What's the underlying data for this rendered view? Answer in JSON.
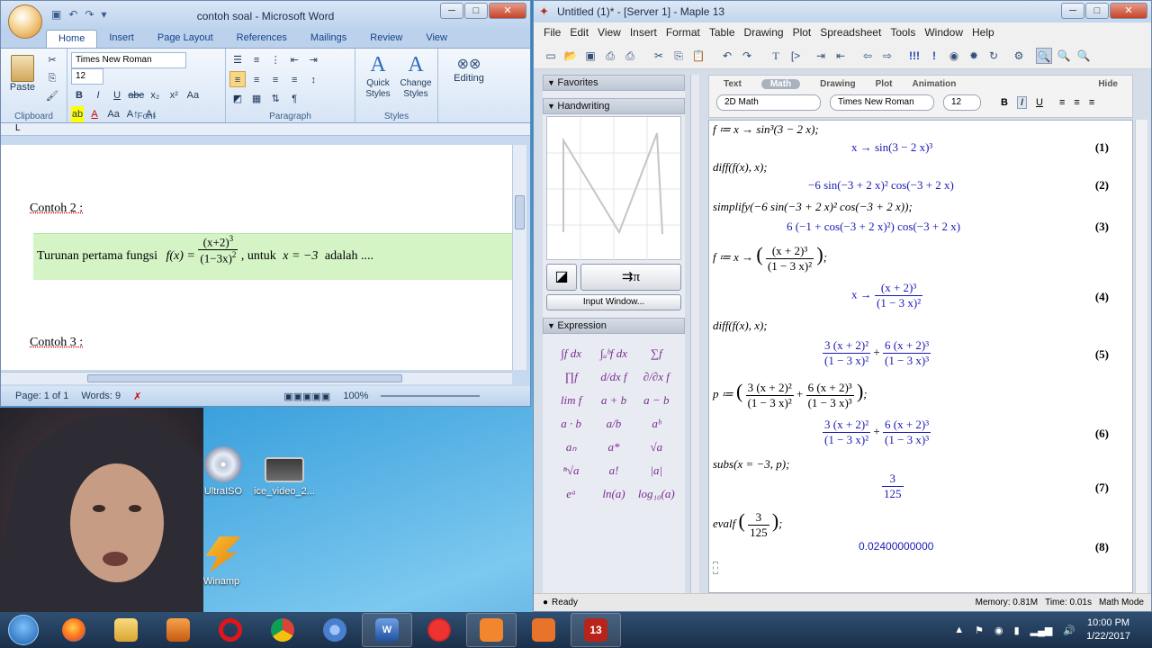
{
  "desktop": {
    "icons": [
      {
        "label": "UltraISO"
      },
      {
        "label": "ice_video_2..."
      },
      {
        "label": "Winamp"
      }
    ]
  },
  "word": {
    "title": "contoh soal - Microsoft Word",
    "tabs": [
      "Home",
      "Insert",
      "Page Layout",
      "References",
      "Mailings",
      "Review",
      "View"
    ],
    "active_tab": "Home",
    "font_name": "Times New Roman",
    "font_size": "12",
    "groups": {
      "clipboard": "Clipboard",
      "font": "Font",
      "paragraph": "Paragraph",
      "styles": "Styles"
    },
    "buttons": {
      "paste": "Paste",
      "quick_styles": "Quick Styles",
      "change_styles": "Change Styles",
      "editing": "Editing"
    },
    "doc": {
      "heading2": "Contoh 2 :",
      "question_prefix": "Turunan pertama fungsi",
      "question_fx": "f(x) =",
      "question_num": "(x+2)",
      "question_num_exp": "3",
      "question_den": "(1−3x)",
      "question_den_exp": "2",
      "question_suffix": ", untuk",
      "question_cond": "x = −3",
      "question_end": "adalah ....",
      "heading3": "Contoh 3 :"
    },
    "status": {
      "page": "Page: 1 of 1",
      "words": "Words: 9",
      "zoom": "100%"
    }
  },
  "maple": {
    "title": "Untitled (1)* - [Server 1] - Maple 13",
    "menu": [
      "File",
      "Edit",
      "View",
      "Insert",
      "Format",
      "Table",
      "Drawing",
      "Plot",
      "Spreadsheet",
      "Tools",
      "Window",
      "Help"
    ],
    "palettes": {
      "favorites": "Favorites",
      "handwriting": "Handwriting",
      "input_window": "Input Window...",
      "expression": "Expression"
    },
    "ctx_tabs": [
      "Text",
      "Math",
      "Drawing",
      "Plot",
      "Animation"
    ],
    "ctx_hide": "Hide",
    "ctx_mode": "2D Math",
    "ctx_font": "Times New Roman",
    "ctx_size": "12",
    "status": {
      "ready": "Ready",
      "memory": "Memory: 0.81M",
      "time": "Time: 0.01s",
      "mode": "Math Mode"
    }
  },
  "worksheet": {
    "in1": "f ≔ x → sin³(3 − 2 x);",
    "out1": "x → sin(3 − 2 x)³",
    "n1": "(1)",
    "in2": "diff(f(x), x);",
    "out2": "−6 sin(−3 + 2 x)² cos(−3 + 2 x)",
    "n2": "(2)",
    "in3": "simplify(−6 sin(−3 + 2 x)² cos(−3 + 2 x));",
    "out3": "6 (−1 + cos(−3 + 2 x)²) cos(−3 + 2 x)",
    "n3": "(3)",
    "in4_prefix": "f ≔ x →",
    "in4_num": "(x + 2)³",
    "in4_den": "(1 − 3 x)²",
    "out4_prefix": "x →",
    "out4_num": "(x + 2)³",
    "out4_den": "(1 − 3 x)²",
    "n4": "(4)",
    "in5": "diff(f(x), x);",
    "out5_a_num": "3 (x + 2)²",
    "out5_a_den": "(1 − 3 x)²",
    "out5_b_num": "6 (x + 2)³",
    "out5_b_den": "(1 − 3 x)³",
    "n5": "(5)",
    "in6_prefix": "p ≔",
    "out6_a_num": "3 (x + 2)²",
    "out6_a_den": "(1 − 3 x)²",
    "out6_b_num": "6 (x + 2)³",
    "out6_b_den": "(1 − 3 x)³",
    "n6": "(6)",
    "in7": "subs(x = −3, p);",
    "out7_num": "3",
    "out7_den": "125",
    "n7": "(7)",
    "in8_prefix": "evalf",
    "in8_num": "3",
    "in8_den": "125",
    "out8": "0.02400000000",
    "n8": "(8)"
  },
  "taskbar": {
    "time": "10:00 PM",
    "date": "1/22/2017"
  }
}
